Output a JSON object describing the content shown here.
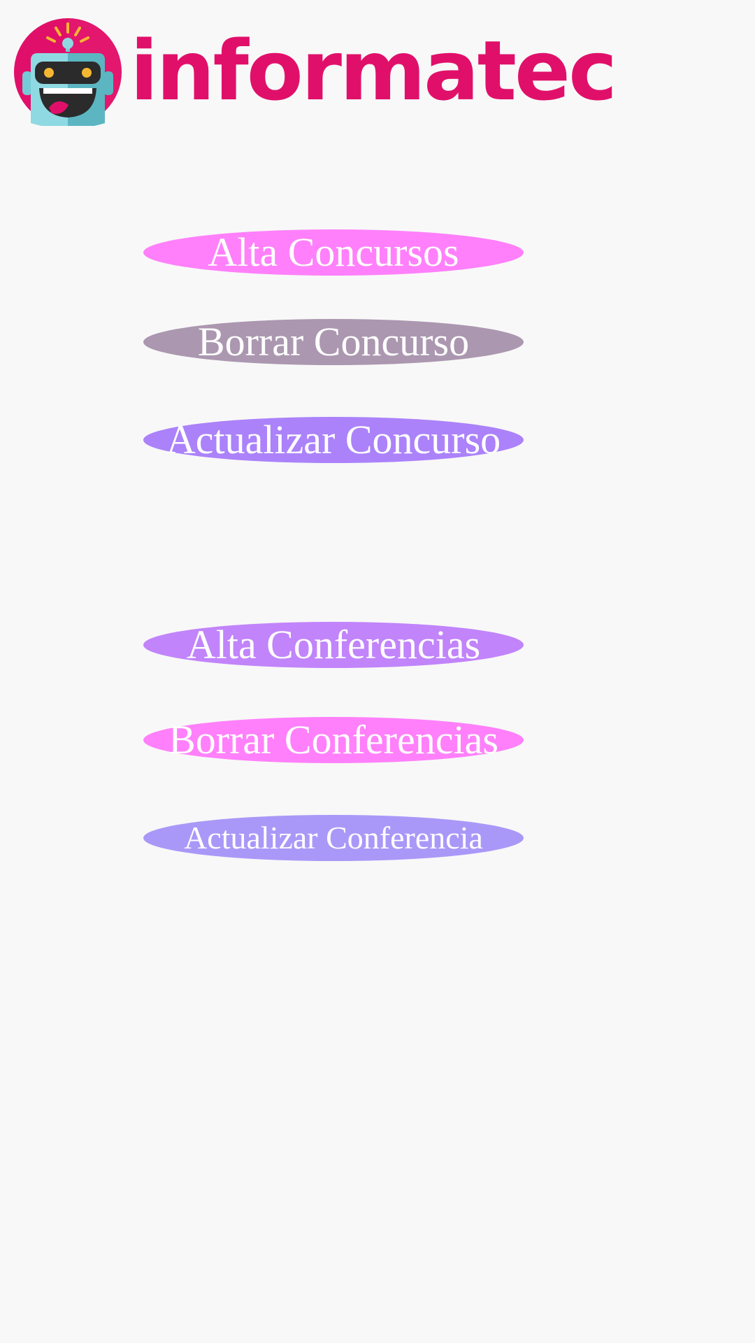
{
  "header": {
    "brand_name": "informatec",
    "logo_icon": "robot-logo-icon"
  },
  "colors": {
    "background": "#f8f8f8",
    "brand": "#e0106a",
    "button_text": "#ffffff"
  },
  "concursos_section": {
    "buttons": [
      {
        "label": "Alta Concursos",
        "color": "#ff80fa"
      },
      {
        "label": "Borrar Concurso",
        "color": "#ab97b0"
      },
      {
        "label": "Actualizar Concurso",
        "color": "#ab82fa"
      }
    ]
  },
  "conferencias_section": {
    "buttons": [
      {
        "label": "Alta Conferencias",
        "color": "#c184fa"
      },
      {
        "label": "Borrar Conferencias",
        "color": "#ff80fa"
      },
      {
        "label": "Actualizar Conferencia",
        "color": "#aa98f8"
      }
    ]
  }
}
